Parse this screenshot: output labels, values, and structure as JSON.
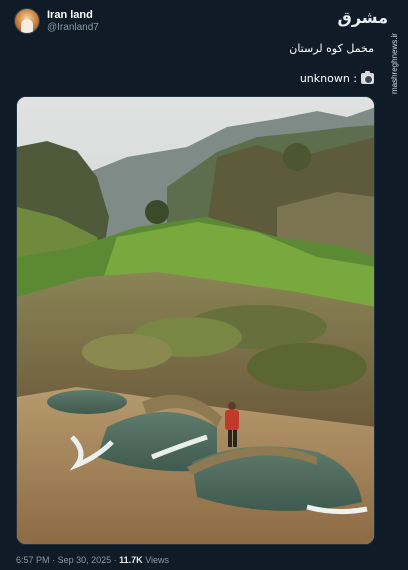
{
  "author": {
    "display_name": "Iran land",
    "handle": "@Iranland7"
  },
  "post": {
    "line1": "مخمل کوه لرستان",
    "line2_text": "unknown :",
    "line2_icon": "camera-icon",
    "image": "photo of a green mossy rocky canyon with water pools and a hiker in a red jacket"
  },
  "footer": {
    "time": "6:57 PM",
    "separator": "·",
    "date": "Sep 30, 2025",
    "views_count": "11.7K",
    "views_label": "Views"
  },
  "watermark": {
    "logo": "مشرق",
    "site": "mashreghnews.ir"
  },
  "colors": {
    "background": "#0f1c28",
    "text": "#e7e9ea",
    "muted": "#8b98a5"
  }
}
